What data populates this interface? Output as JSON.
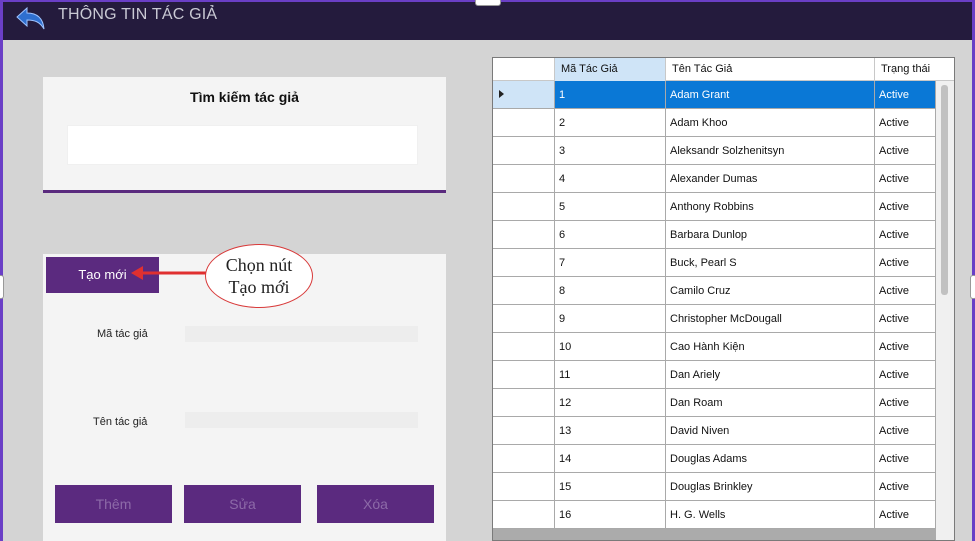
{
  "window": {
    "title": "THÔNG TIN TÁC GIẢ"
  },
  "search": {
    "title": "Tìm kiếm tác giả",
    "value": "",
    "placeholder": ""
  },
  "form": {
    "create_label": "Tạo mới",
    "author_id_label": "Mã tác giả",
    "author_name_label": "Tên tác giả",
    "author_id_value": "",
    "author_name_value": "",
    "add_label": "Thêm",
    "edit_label": "Sửa",
    "delete_label": "Xóa"
  },
  "annotation": {
    "line1": "Chọn nút",
    "line2": "Tạo mới"
  },
  "grid": {
    "columns": [
      "Mã Tác Giả",
      "Tên Tác Giả",
      "Trạng thái"
    ],
    "rows": [
      [
        "1",
        "Adam Grant",
        "Active"
      ],
      [
        "2",
        "Adam Khoo",
        "Active"
      ],
      [
        "3",
        "Aleksandr Solzhenitsyn",
        "Active"
      ],
      [
        "4",
        "Alexander Dumas",
        "Active"
      ],
      [
        "5",
        "Anthony Robbins",
        "Active"
      ],
      [
        "6",
        "Barbara Dunlop",
        "Active"
      ],
      [
        "7",
        "Buck, Pearl S",
        "Active"
      ],
      [
        "8",
        "Camilo Cruz",
        "Active"
      ],
      [
        "9",
        "Christopher McDougall",
        "Active"
      ],
      [
        "10",
        "Cao Hành Kiện",
        "Active"
      ],
      [
        "11",
        "Dan Ariely",
        "Active"
      ],
      [
        "12",
        "Dan Roam",
        "Active"
      ],
      [
        "13",
        "David Niven",
        "Active"
      ],
      [
        "14",
        "Douglas Adams",
        "Active"
      ],
      [
        "15",
        "Douglas Brinkley",
        "Active"
      ],
      [
        "16",
        "H. G. Wells",
        "Active"
      ]
    ],
    "selected_index": 0
  },
  "colors": {
    "accent": "#5b2a7f",
    "titlebar": "#241b3d",
    "selection": "#0a78d6",
    "frame": "#6a3fc6"
  }
}
